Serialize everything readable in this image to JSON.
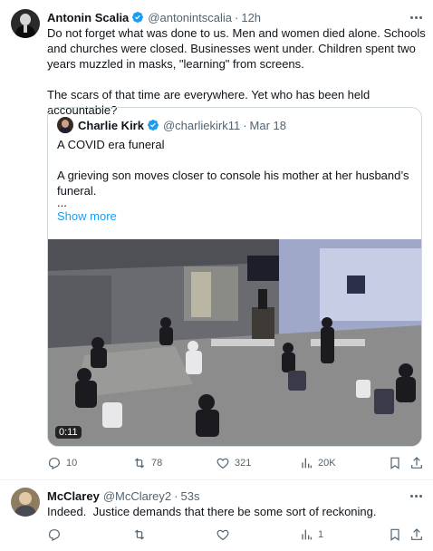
{
  "tweet": {
    "author_name": "Antonin Scalia",
    "handle": "@antonintscalia",
    "time": "12h",
    "lines": [
      "Do not forget what was done to us. Men and women died alone. Schools",
      "and churches were closed. Businesses went under. Children spent two",
      "years muzzled in masks, \"learning\" from screens.",
      "The scars of that time are everywhere. Yet who has been held accountable?"
    ],
    "actions": {
      "replies": "10",
      "reposts": "78",
      "likes": "321",
      "views": "20K"
    }
  },
  "quote": {
    "author_name": "Charlie Kirk",
    "handle": "@charliekirk11",
    "date": "Mar 18",
    "line1": "A COVID era funeral",
    "line2": "A grieving son moves closer to console his mother at her husband’s",
    "line3": "funeral.",
    "ellipsis": "...",
    "show_more": "Show more",
    "video_duration": "0:11"
  },
  "reply": {
    "author_name": "McClarey",
    "handle": "@McClarey2",
    "time": "53s",
    "text": "Indeed.  Justice demands that there be some sort of reckoning.",
    "actions": {
      "views": "1"
    }
  },
  "colors": {
    "accent": "#1d9bf0",
    "muted": "#536471",
    "border": "#cfd9de",
    "text": "#0f1419"
  }
}
